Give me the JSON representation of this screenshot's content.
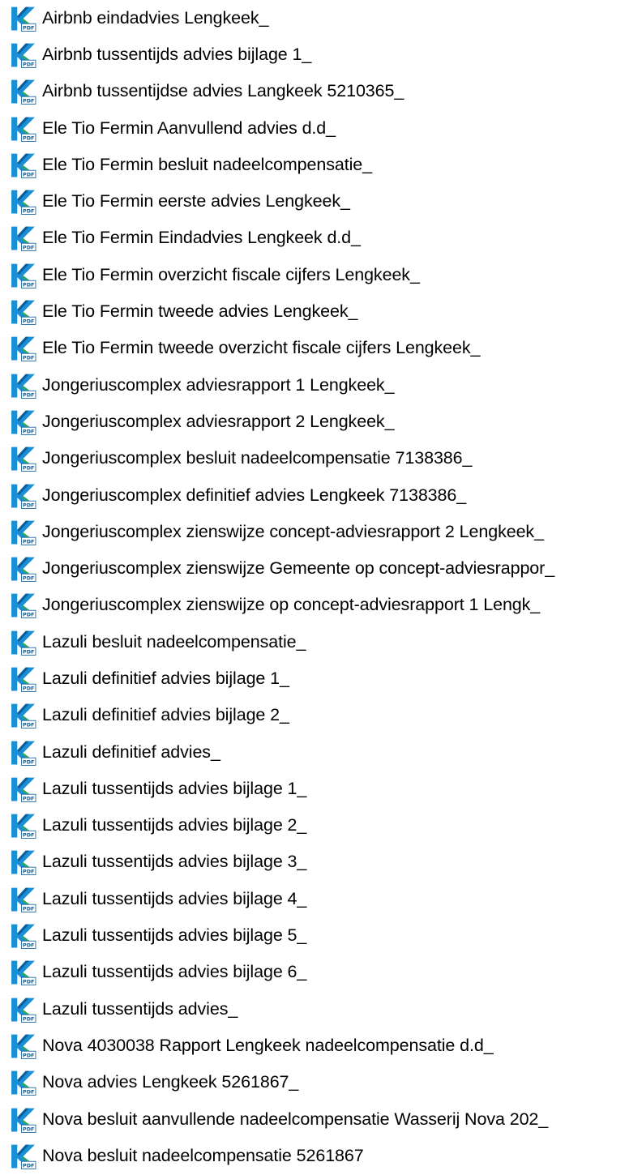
{
  "file_icon": "pdf-file-icon",
  "colors": {
    "icon_blue": "#1a8fd6",
    "icon_dark": "#0b5d9c",
    "icon_green": "#2eaa56",
    "text": "#000000",
    "background": "#ffffff"
  },
  "files": [
    {
      "name": "Airbnb eindadvies Lengkeek_"
    },
    {
      "name": "Airbnb tussentijds advies bijlage 1_"
    },
    {
      "name": "Airbnb tussentijdse advies Langkeek  5210365_"
    },
    {
      "name": "Ele Tio Fermin Aanvullend advies d.d_"
    },
    {
      "name": "Ele Tio Fermin besluit nadeelcompensatie_"
    },
    {
      "name": "Ele Tio Fermin eerste advies Lengkeek_"
    },
    {
      "name": "Ele Tio Fermin Eindadvies Lengkeek d.d_"
    },
    {
      "name": "Ele Tio Fermin overzicht fiscale cijfers Lengkeek_"
    },
    {
      "name": "Ele Tio Fermin tweede advies Lengkeek_"
    },
    {
      "name": "Ele Tio Fermin tweede overzicht fiscale cijfers Lengkeek_"
    },
    {
      "name": "Jongeriuscomplex adviesrapport 1 Lengkeek_"
    },
    {
      "name": "Jongeriuscomplex adviesrapport 2 Lengkeek_"
    },
    {
      "name": "Jongeriuscomplex besluit nadeelcompensatie 7138386_"
    },
    {
      "name": "Jongeriuscomplex definitief advies Lengkeek 7138386_"
    },
    {
      "name": "Jongeriuscomplex zienswijze concept-adviesrapport 2 Lengkeek_"
    },
    {
      "name": "Jongeriuscomplex zienswijze Gemeente op concept-adviesrappor_"
    },
    {
      "name": "Jongeriuscomplex zienswijze op concept-adviesrapport 1 Lengk_"
    },
    {
      "name": "Lazuli besluit nadeelcompensatie_"
    },
    {
      "name": "Lazuli definitief advies bijlage 1_"
    },
    {
      "name": "Lazuli definitief advies bijlage 2_"
    },
    {
      "name": "Lazuli definitief advies_"
    },
    {
      "name": "Lazuli tussentijds advies bijlage 1_"
    },
    {
      "name": "Lazuli tussentijds advies bijlage 2_"
    },
    {
      "name": "Lazuli tussentijds advies bijlage 3_"
    },
    {
      "name": "Lazuli tussentijds advies bijlage 4_"
    },
    {
      "name": "Lazuli tussentijds advies bijlage 5_"
    },
    {
      "name": "Lazuli tussentijds advies bijlage 6_"
    },
    {
      "name": "Lazuli tussentijds advies_"
    },
    {
      "name": "Nova 4030038 Rapport Lengkeek nadeelcompensatie d.d_"
    },
    {
      "name": "Nova advies Lengkeek 5261867_"
    },
    {
      "name": "Nova besluit aanvullende nadeelcompensatie Wasserij Nova 202_"
    },
    {
      "name": "Nova besluit nadeelcompensatie 5261867"
    }
  ]
}
